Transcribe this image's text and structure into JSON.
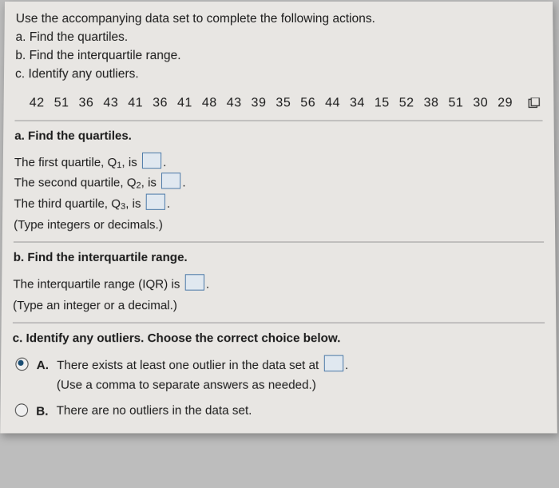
{
  "prompt": {
    "lead": "Use the accompanying data set to complete the following actions.",
    "a": "a. Find the quartiles.",
    "b": "b. Find the interquartile range.",
    "c": "c. Identify any outliers."
  },
  "data_values": "42  51  36  43  41  36  41  48  43  39  35  56  44  34  15  52  38  51  30  29",
  "section_a": {
    "header": "a. Find the quartiles.",
    "q1_pre": "The first quartile, Q",
    "q1_sub": "1",
    "q1_post": ", is ",
    "q2_pre": "The second quartile, Q",
    "q2_sub": "2",
    "q2_post": ", is ",
    "q3_pre": "The third quartile, Q",
    "q3_sub": "3",
    "q3_post": ", is ",
    "period": ".",
    "hint": "(Type integers or decimals.)"
  },
  "section_b": {
    "header": "b. Find the interquartile range.",
    "line_pre": "The interquartile range (IQR) is ",
    "period": ".",
    "hint": "(Type an integer or a decimal.)"
  },
  "section_c": {
    "header": "c. Identify any outliers. Choose the correct choice below.",
    "A_label": "A.",
    "A_line1_pre": "There exists at least one outlier in the data set at ",
    "A_line1_post": ".",
    "A_hint": "(Use a comma to separate answers as needed.)",
    "B_label": "B.",
    "B_text": "There are no outliers in the data set."
  }
}
